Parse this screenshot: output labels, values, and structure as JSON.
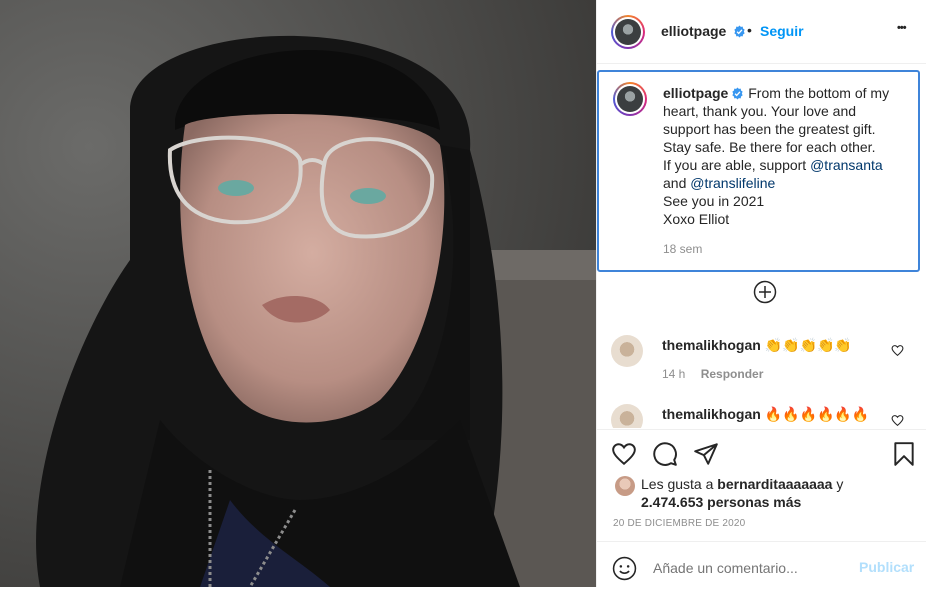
{
  "post": {
    "username": "elliotpage",
    "follow_label": "Seguir",
    "separator": "•",
    "more_label": "•••"
  },
  "caption": {
    "username": "elliotpage",
    "line1": "From the bottom of my",
    "line2": "heart, thank you. Your love and",
    "line3": "support has been the greatest gift.",
    "line4": "Stay safe. Be there for each other.",
    "line5_pre": "If you are able, support ",
    "mention1": "@transanta",
    "line6_pre": "and ",
    "mention2": "@translifeline",
    "line7": "See you in 2021",
    "line8": "Xoxo Elliot",
    "time": "18 sem"
  },
  "comments": [
    {
      "username": "themalikhogan",
      "text": "👏👏👏👏👏",
      "time": "14 h",
      "reply_label": "Responder"
    },
    {
      "username": "themalikhogan",
      "text": "🔥🔥🔥🔥🔥🔥"
    }
  ],
  "likes": {
    "prefix": "Les gusta a ",
    "user": "bernarditaaaaaaa",
    "joiner": " y",
    "count": "2.474.653 personas más"
  },
  "date": "20 DE DICIEMBRE DE 2020",
  "comment_box": {
    "placeholder": "Añade un comentario...",
    "publish_label": "Publicar"
  },
  "colors": {
    "accent": "#0095f6",
    "mention": "#00376b",
    "focus_border": "#3f84d9",
    "verified": "#3897f0"
  },
  "icons": [
    "verified-badge-icon",
    "more-options-icon",
    "load-more-icon",
    "heart-icon",
    "comment-icon",
    "share-icon",
    "bookmark-icon",
    "emoji-icon"
  ]
}
